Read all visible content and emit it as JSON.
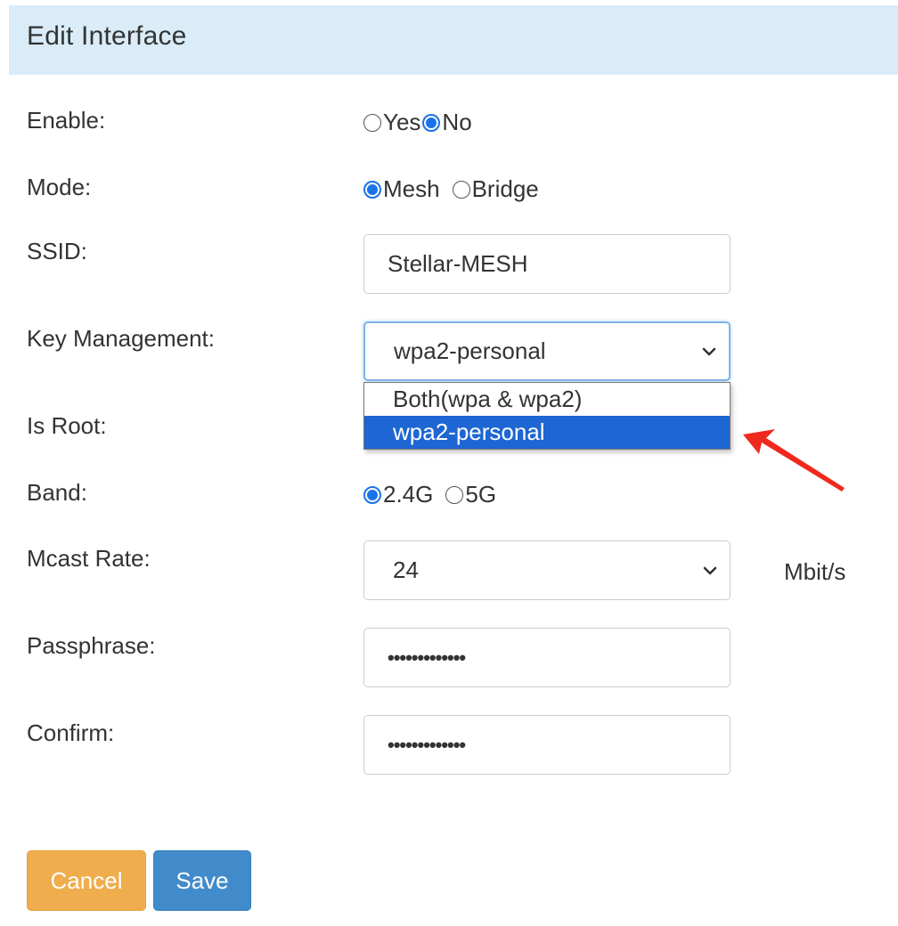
{
  "header": {
    "title": "Edit Interface"
  },
  "form": {
    "enable": {
      "label": "Enable:",
      "options": [
        "Yes",
        "No"
      ],
      "selected": "No"
    },
    "mode": {
      "label": "Mode:",
      "options": [
        "Mesh",
        "Bridge"
      ],
      "selected": "Mesh"
    },
    "ssid": {
      "label": "SSID:",
      "value": "Stellar-MESH"
    },
    "key_management": {
      "label": "Key Management:",
      "value": "wpa2-personal",
      "options": [
        "Both(wpa & wpa2)",
        "wpa2-personal"
      ],
      "selected": "wpa2-personal"
    },
    "is_root": {
      "label": "Is Root:"
    },
    "band": {
      "label": "Band:",
      "options": [
        "2.4G",
        "5G"
      ],
      "selected": "2.4G"
    },
    "mcast_rate": {
      "label": "Mcast Rate:",
      "value": "24",
      "unit": "Mbit/s"
    },
    "passphrase": {
      "label": "Passphrase:",
      "value": "•••••••••••••"
    },
    "confirm": {
      "label": "Confirm:",
      "value": "•••••••••••••"
    }
  },
  "buttons": {
    "cancel": "Cancel",
    "save": "Save"
  },
  "colors": {
    "header_bg": "#d9ecf7",
    "radio_accent": "#1a73e8",
    "dropdown_highlight": "#1d66d3",
    "cancel_button": "#efad4d",
    "save_button": "#428bca",
    "annotation_arrow": "#f0291e"
  }
}
